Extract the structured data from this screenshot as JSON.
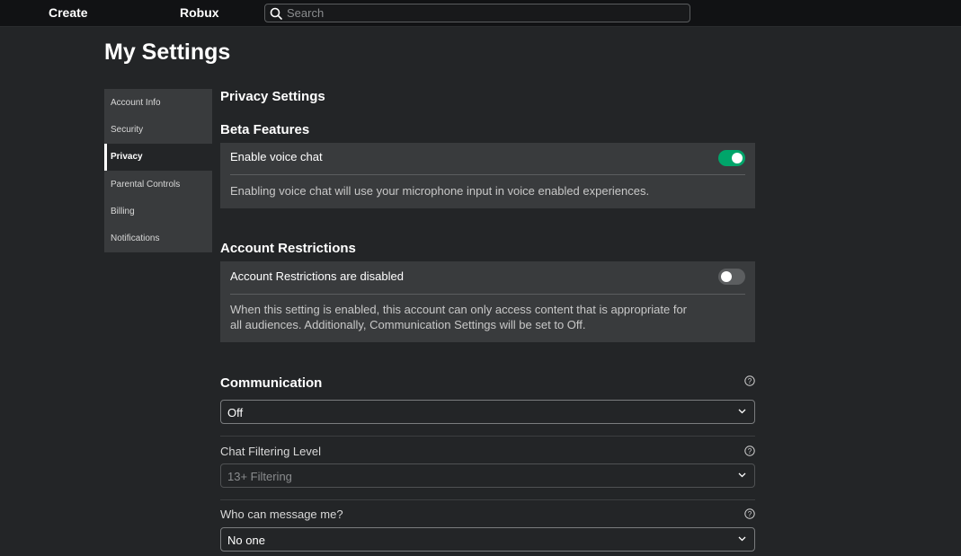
{
  "topbar": {
    "create_label": "Create",
    "robux_label": "Robux",
    "search_placeholder": "Search"
  },
  "page_title": "My Settings",
  "sidebar": {
    "items": [
      {
        "label": "Account Info"
      },
      {
        "label": "Security"
      },
      {
        "label": "Privacy"
      },
      {
        "label": "Parental Controls"
      },
      {
        "label": "Billing"
      },
      {
        "label": "Notifications"
      }
    ],
    "active": "Privacy"
  },
  "privacy": {
    "heading": "Privacy Settings",
    "beta": {
      "heading": "Beta Features",
      "voice_label": "Enable voice chat",
      "voice_enabled": true,
      "voice_desc": "Enabling voice chat will use your microphone input in voice enabled experiences."
    },
    "restrictions": {
      "heading": "Account Restrictions",
      "label": "Account Restrictions are disabled",
      "enabled": false,
      "desc_line1": "When this setting is enabled, this account can only access content that is appropriate for",
      "desc_line2": "all audiences. Additionally, Communication Settings will be set to Off."
    },
    "communication": {
      "heading": "Communication",
      "value": "Off",
      "chat_filter_label": "Chat Filtering Level",
      "chat_filter_value": "13+ Filtering",
      "message_label": "Who can message me?",
      "message_value": "No one"
    }
  },
  "colors": {
    "background": "#232527",
    "topbar": "#111214",
    "card": "#393b3d",
    "toggle_on": "#00a56a",
    "toggle_off": "#5c5e60"
  }
}
